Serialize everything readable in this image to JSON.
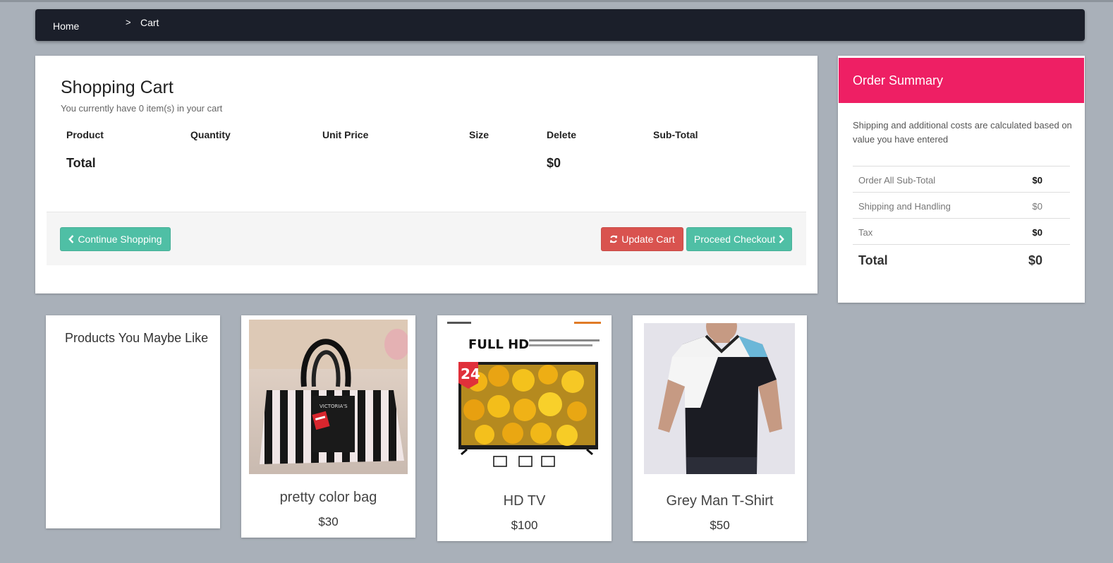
{
  "breadcrumb": {
    "home": "Home",
    "separator": ">",
    "current": "Cart"
  },
  "cart": {
    "title": "Shopping Cart",
    "subtitle": "You currently have 0 item(s) in your cart",
    "columns": [
      "Product",
      "Quantity",
      "Unit Price",
      "Size",
      "Delete",
      "Sub-Total"
    ],
    "total_label": "Total",
    "total_value": "$0",
    "continue_label": "Continue Shopping",
    "update_label": "Update Cart",
    "checkout_label": "Proceed Checkout"
  },
  "summary": {
    "title": "Order Summary",
    "note": "Shipping and additional costs are calculated based on value you have entered",
    "rows": [
      {
        "label": "Order All Sub-Total",
        "value": "$0"
      },
      {
        "label": "Shipping and Handling",
        "value": "$0"
      },
      {
        "label": "Tax",
        "value": "$0"
      }
    ],
    "total_label": "Total",
    "total_value": "$0"
  },
  "recommendations": {
    "title": "Products You Maybe Like",
    "products": [
      {
        "name": "pretty color bag",
        "price": "$30",
        "icon": "bag-image"
      },
      {
        "name": "HD TV",
        "price": "$100",
        "icon": "tv-image",
        "image_text": {
          "headline": "FULL HD",
          "badge": "24"
        }
      },
      {
        "name": "Grey Man T-Shirt",
        "price": "$50",
        "icon": "tshirt-image"
      }
    ]
  },
  "colors": {
    "background": "#a9b0b9",
    "navbar": "#1b1f2a",
    "accent_pink": "#ee1f64",
    "teal": "#4fbfa5",
    "red": "#d9534f"
  }
}
